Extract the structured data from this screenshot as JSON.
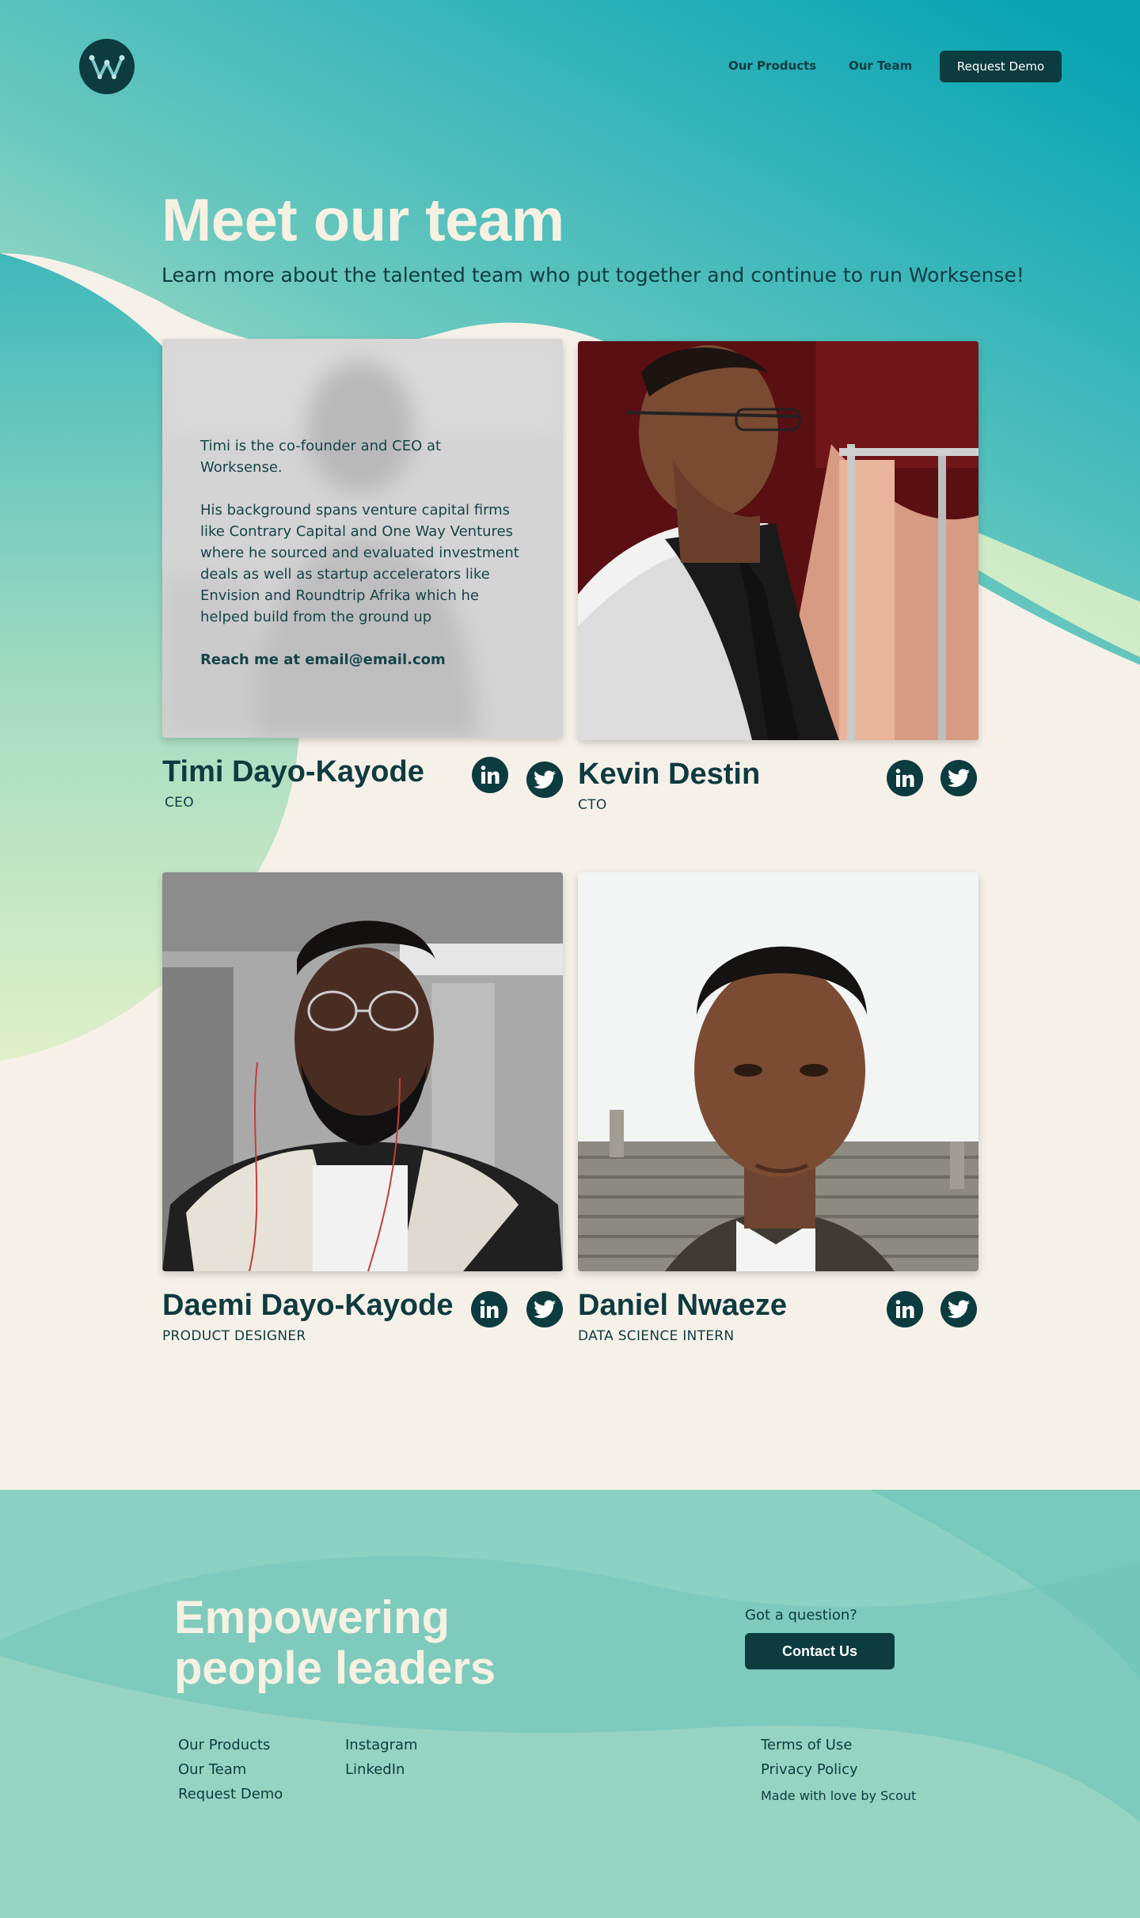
{
  "header": {
    "nav_products": "Our Products",
    "nav_team": "Our Team",
    "cta": "Request Demo"
  },
  "hero": {
    "title": "Meet our team",
    "subtitle": "Learn more about the talented team who put together and continue to run Worksense!"
  },
  "team": [
    {
      "name": "Timi Dayo-Kayode",
      "role": "CEO",
      "bio_1": "Timi is the co-founder and CEO at Worksense.",
      "bio_2": "His background spans venture capital firms like Contrary Capital and One Way Ventures where he sourced and evaluated investment deals as well as startup accelerators like Envision and Roundtrip Afrika which he helped build from the ground up",
      "bio_contact": "Reach me at email@email.com"
    },
    {
      "name": "Kevin Destin",
      "role": "CTO"
    },
    {
      "name": "Daemi Dayo-Kayode",
      "role": "PRODUCT DESIGNER"
    },
    {
      "name": "Daniel Nwaeze",
      "role": "DATA SCIENCE INTERN"
    }
  ],
  "footer": {
    "title": "Empowering people leaders",
    "question": "Got a question?",
    "contact_button": "Contact Us",
    "links_col1": [
      "Our Products",
      "Our Team",
      "Request Demo"
    ],
    "links_col2": [
      "Instagram",
      "LinkedIn"
    ],
    "links_col3": [
      "Terms of Use",
      "Privacy Policy"
    ],
    "credit": "Made with love by Scout"
  },
  "colors": {
    "brand_dark": "#0c3b40",
    "cream": "#f6f1e8",
    "teal": "#0aa6b5",
    "mint": "#dcefc7"
  },
  "icons": [
    "worksense-logo-icon",
    "linkedin-icon",
    "twitter-icon"
  ]
}
